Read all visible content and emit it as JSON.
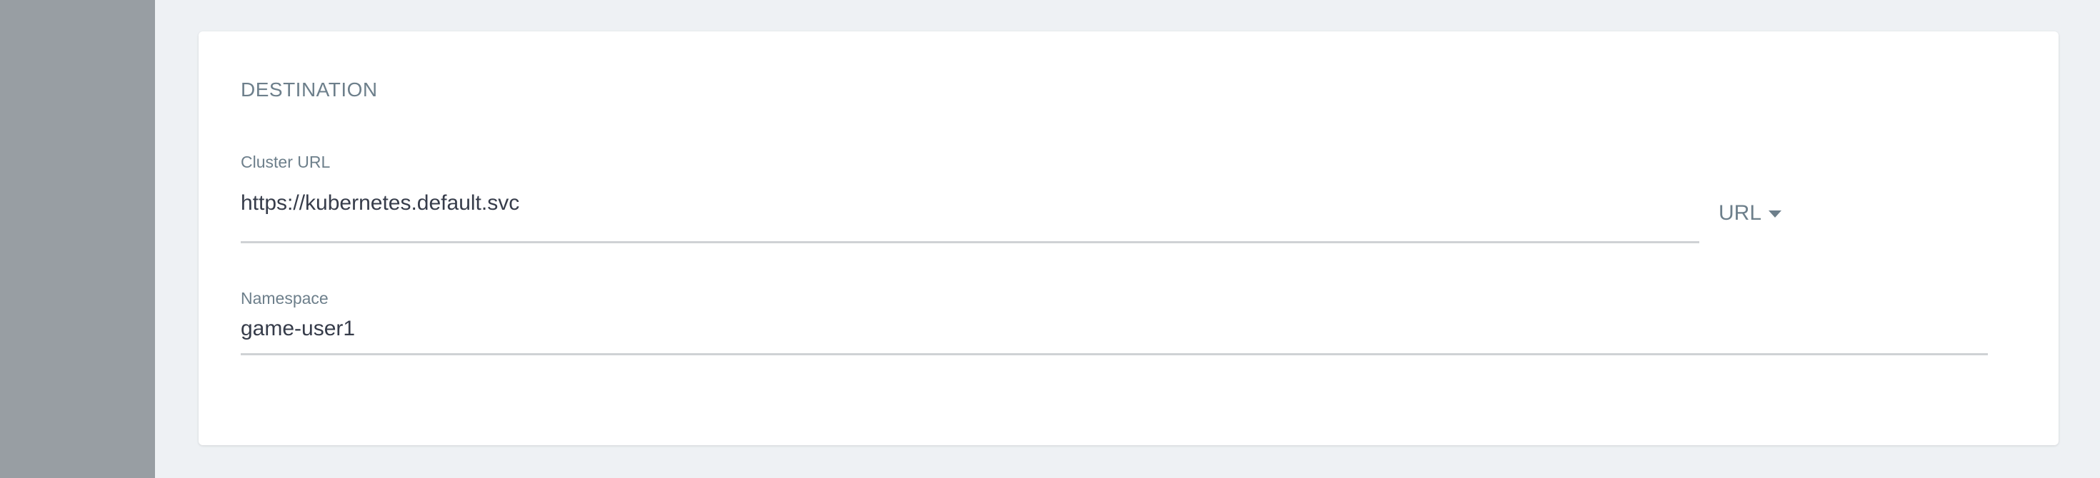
{
  "destination": {
    "section_title": "DESTINATION",
    "cluster_url": {
      "label": "Cluster URL",
      "value": "https://kubernetes.default.svc",
      "mode_toggle_label": "URL"
    },
    "namespace": {
      "label": "Namespace",
      "value": "game-user1"
    }
  },
  "colors": {
    "sidebar": "#989ea3",
    "background": "#eef1f4",
    "card": "#ffffff",
    "label_text": "#6d7f8b",
    "value_text": "#363c4a",
    "underline": "#cfd2d5"
  },
  "icons": {
    "mode_toggle": "caret-down-icon"
  }
}
